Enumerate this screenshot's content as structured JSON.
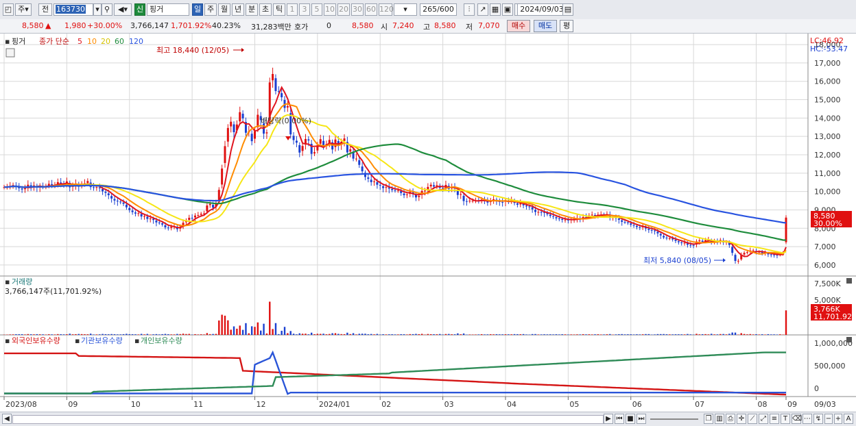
{
  "toolbar": {
    "market_label": "주",
    "prev_label": "전",
    "code": "163730",
    "name_tag": "신",
    "stock_name": "핑거",
    "periods": [
      "일",
      "주",
      "월",
      "년",
      "분",
      "초",
      "틱"
    ],
    "selected_period": "일",
    "minute_units": [
      "1",
      "3",
      "5",
      "10",
      "20",
      "30",
      "60",
      "120"
    ],
    "count": "265",
    "count_total": "/600",
    "date": "2024/09/03"
  },
  "infobar": {
    "price": "8,580",
    "change": "1,980",
    "change_pct": "+30.00%",
    "volume": "3,766,147",
    "volume_pct": "1,701.92%",
    "turnover_pct": "40.23%",
    "amount": "31,283백만",
    "quote_label": "호가",
    "quote_value": "0",
    "quote_price": "8,580",
    "open_label": "시",
    "open": "7,240",
    "high_label": "고",
    "high": "8,580",
    "low_label": "저",
    "low": "7,070",
    "buy_label": "매수",
    "sell_label": "매도",
    "eval_label": "평"
  },
  "price_panel": {
    "name_label": "핑거",
    "legend_prefix": "종가 단순",
    "ma_periods": [
      "5",
      "10",
      "20",
      "60",
      "120"
    ],
    "ma_colors": [
      "#e0141e",
      "#ff8c00",
      "#f6e615",
      "#1e8c3c",
      "#2853e0"
    ],
    "lc": "LC:46.92",
    "hc": "HC:-53.47",
    "y_ticks": [
      "18,000",
      "17,000",
      "16,000",
      "15,000",
      "14,000",
      "13,000",
      "12,000",
      "11,000",
      "10,000",
      "9,000",
      "8,000",
      "7,000",
      "6,000"
    ],
    "last_price_tag": "8,580",
    "last_pct_tag": "30.00%",
    "high_annotation": "최고 18,440 (12/05)",
    "low_annotation": "최저 5,840 (08/05)",
    "dividend_annotation": "배당락(0.00%)"
  },
  "volume_panel": {
    "title": "거래량",
    "value_text": "3,766,147주(11,701.92%)",
    "y_ticks": [
      "7,500K",
      "5,000K"
    ],
    "tag_value": "3,766K",
    "tag_pct": "11,701.92%"
  },
  "holding_panel": {
    "series": [
      "외국인보유수량",
      "기관보유수량",
      "개인보유수량"
    ],
    "series_colors": [
      "#d41414",
      "#2a55d8",
      "#2e8b57"
    ],
    "y_ticks": [
      "1,000,000",
      "500,000",
      "0"
    ]
  },
  "x_axis": {
    "labels": [
      "2023/08",
      "09",
      "10",
      "11",
      "12",
      "2024/01",
      "02",
      "03",
      "04",
      "05",
      "06",
      "07",
      "08",
      "09"
    ],
    "right_label": "09/03"
  },
  "colors": {
    "up": "#e01010",
    "down": "#1a3fd0",
    "selected": "#2d63b5",
    "grid": "#d8d8d8"
  },
  "chart_data": {
    "type": "candlestick",
    "price_range": [
      5400,
      18600
    ],
    "daily_closes": [
      10240,
      10250,
      10300,
      10350,
      10260,
      10180,
      10110,
      10180,
      10370,
      10260,
      10330,
      10220,
      10280,
      10250,
      10290,
      10420,
      10350,
      10370,
      10510,
      10430,
      10410,
      10550,
      10230,
      10320,
      10440,
      10260,
      10380,
      10440,
      10570,
      10240,
      10210,
      10240,
      10180,
      10010,
      9930,
      9800,
      9620,
      9510,
      9460,
      9420,
      9330,
      9140,
      8990,
      8880,
      8800,
      8820,
      8640,
      8660,
      8510,
      8530,
      8450,
      8320,
      8290,
      8200,
      8050,
      8000,
      8070,
      8120,
      7950,
      8070,
      8300,
      8420,
      8570,
      8560,
      8690,
      8720,
      8790,
      8810,
      9240,
      9330,
      9120,
      9350,
      10090,
      11250,
      12470,
      13460,
      13800,
      13230,
      13650,
      14320,
      13980,
      13200,
      13280,
      12740,
      13280,
      14180,
      13890,
      13150,
      13220,
      15940,
      16400,
      15470,
      15430,
      15130,
      14550,
      14650,
      13110,
      12800,
      12660,
      12120,
      12480,
      12860,
      12780,
      12050,
      12140,
      12520,
      12850,
      12470,
      12580,
      12810,
      12290,
      12830,
      12490,
      12710,
      12890,
      12130,
      12300,
      11790,
      11790,
      11450,
      11100,
      10790,
      10690,
      10510,
      10550,
      10370,
      10320,
      10190,
      10240,
      10160,
      10080,
      10070,
      10070,
      9920,
      9800,
      9840,
      9980,
      9870,
      9680,
      9760,
      10030,
      10050,
      10250,
      10370,
      10270,
      10340,
      10200,
      10150,
      10360,
      10150,
      10240,
      10170,
      9810,
      9860,
      9480,
      9470,
      9500,
      9500,
      9500,
      9490,
      9560,
      9480,
      9400,
      9510,
      9580,
      9480,
      9440,
      9410,
      9530,
      9430,
      9510,
      9380,
      9280,
      9350,
      9250,
      9190,
      9180,
      9030,
      8890,
      8890,
      8880,
      8840,
      8760,
      8670,
      8620,
      8540,
      8520,
      8460,
      8470,
      8430,
      8480,
      8500,
      8550,
      8530,
      8610,
      8590,
      8690,
      8740,
      8660,
      8740,
      8740,
      8730,
      8770,
      8600,
      8600,
      8550,
      8460,
      8350,
      8330,
      8290,
      8190,
      8150,
      8070,
      8040,
      8090,
      7990,
      7910,
      7890,
      7840,
      7720,
      7610,
      7500,
      7450,
      7460,
      7390,
      7310,
      7240,
      7190,
      7210,
      7100,
      7090,
      7080,
      7280,
      7340,
      7260,
      7350,
      7370,
      7220,
      7290,
      7230,
      7360,
      7230,
      7260,
      7090,
      6660,
      6220,
      6230,
      6540,
      6660,
      6700,
      6790,
      6790,
      6690,
      6720,
      6650,
      6650,
      6580,
      6570,
      6560,
      6530,
      6600,
      6600,
      8580
    ],
    "holdings_series": [
      {
        "name": "외국인보유수량",
        "trend": "high-then-declining"
      },
      {
        "name": "기관보유수량",
        "trend": "near-zero-spike-in-Dec"
      },
      {
        "name": "개인보유수량",
        "trend": "rising"
      }
    ]
  }
}
